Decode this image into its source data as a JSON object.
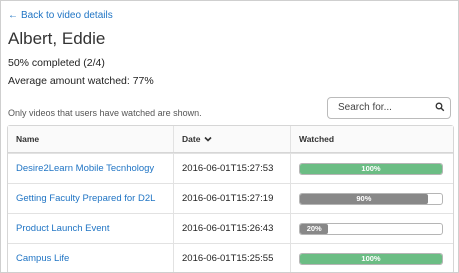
{
  "back_link": {
    "label": "Back to video details",
    "icon": "arrow-left-icon"
  },
  "user": {
    "name": "Albert, Eddie",
    "completed_text": "50% completed (2/4)",
    "average_text": "Average amount watched: 77%"
  },
  "note": "Only videos that users have watched are shown.",
  "search": {
    "placeholder": "Search for...",
    "icon": "search-icon"
  },
  "table": {
    "headers": {
      "name": "Name",
      "date": "Date",
      "watched": "Watched"
    },
    "sort_indicator": "chevron-down-icon",
    "rows": [
      {
        "name": "Desire2Learn Mobile Tecnhology",
        "date": "2016-06-01T15:27:53",
        "watched_label": "100%",
        "watched_fraction": 1.0,
        "bar_color": "#6bbd84"
      },
      {
        "name": "Getting Faculty Prepared for D2L",
        "date": "2016-06-01T15:27:19",
        "watched_label": "90%",
        "watched_fraction": 0.9,
        "bar_color": "#888888"
      },
      {
        "name": "Product Launch Event",
        "date": "2016-06-01T15:26:43",
        "watched_label": "20%",
        "watched_fraction": 0.2,
        "bar_color": "#888888"
      },
      {
        "name": "Campus Life",
        "date": "2016-06-01T15:25:55",
        "watched_label": "100%",
        "watched_fraction": 1.0,
        "bar_color": "#6bbd84"
      }
    ]
  },
  "colors": {
    "link": "#1f74c4",
    "complete_bar": "#6bbd84",
    "partial_bar": "#888888"
  }
}
